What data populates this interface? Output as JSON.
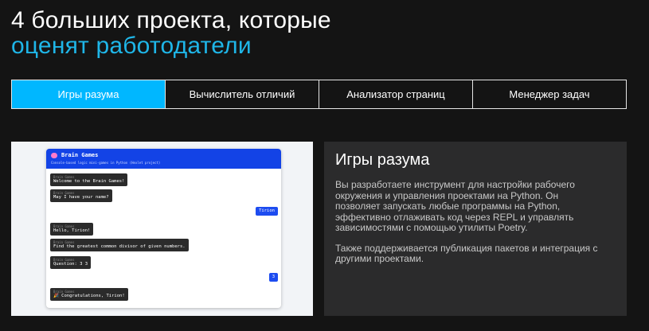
{
  "header": {
    "title_line1": "4 больших проекта, которые",
    "title_line2": "оценят работодатели"
  },
  "tabs": [
    {
      "label": "Игры разума",
      "active": true
    },
    {
      "label": "Вычислитель отличий",
      "active": false
    },
    {
      "label": "Анализатор страниц",
      "active": false
    },
    {
      "label": "Менеджер задач",
      "active": false
    }
  ],
  "preview": {
    "app_title": "Brain Games",
    "app_subtitle": "Console-based logic mini-games in Python (Hexlet project)",
    "messages": [
      {
        "who": "Brain Games",
        "text": "Welcome to the Brain Games!",
        "side": "bot"
      },
      {
        "who": "Brain Games",
        "text": "May I have your name?",
        "side": "bot"
      },
      {
        "who": "",
        "text": "Tirion",
        "side": "user"
      },
      {
        "who": "Brain Games",
        "text": "Hello, Tirion!",
        "side": "bot"
      },
      {
        "who": "Brain Games",
        "text": "Find the greatest common divisor of given numbers.",
        "side": "bot"
      },
      {
        "who": "Brain Games",
        "text": "Question: 3 3",
        "side": "bot"
      },
      {
        "who": "",
        "text": "3",
        "side": "user"
      },
      {
        "who": "Brain Games",
        "text": "🎉 Congratulations, Tirion!",
        "side": "bot"
      }
    ]
  },
  "panel": {
    "heading": "Игры разума",
    "paragraph1": "Вы разработаете инструмент для настройки рабочего окружения и управления проектами на Python. Он позволяет запускать любые программы на Python, эффективно отлаживать код через REPL и управлять зависимостями с помощью утилиты Poetry.",
    "paragraph2": "Также поддерживается публикация пакетов и интеграция с другими проектами."
  },
  "colors": {
    "background": "#141414",
    "accent": "#1fb6e8",
    "active_tab": "#00b7ff",
    "panel": "#2b2b2c",
    "app_header": "#1343e6"
  }
}
